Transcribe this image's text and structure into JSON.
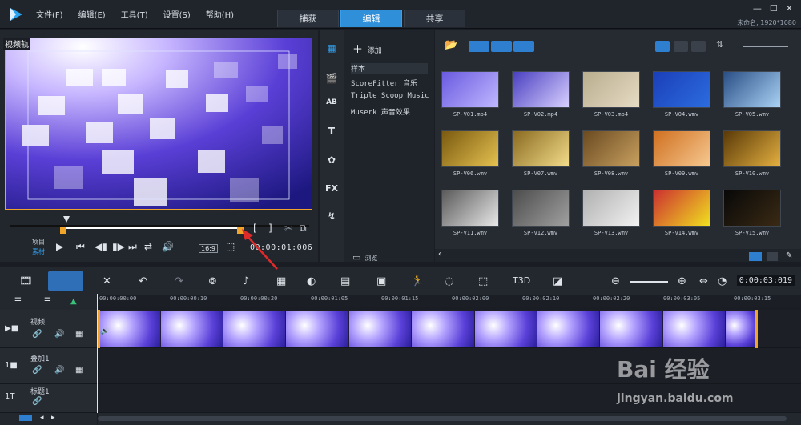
{
  "menu": [
    "文件(F)",
    "编辑(E)",
    "工具(T)",
    "设置(S)",
    "帮助(H)"
  ],
  "tabs": [
    {
      "label": "捕获"
    },
    {
      "label": "编辑",
      "active": true
    },
    {
      "label": "共享"
    }
  ],
  "project_info": "未命名, 1920*1080",
  "preview": {
    "track_label": "视频轨",
    "mode_project": "项目",
    "mode_clip": "素材",
    "aspect": "16:9",
    "timecode": "00:00:01:006"
  },
  "library": {
    "add_label": "添加",
    "items": [
      "样本",
      "ScoreFitter 音乐",
      "Triple Scoop Music",
      "Muserk 声音效果"
    ],
    "browse_label": "浏览"
  },
  "media": {
    "files": [
      "SP-V01.mp4",
      "SP-V02.mp4",
      "SP-V03.mp4",
      "SP-V04.wmv",
      "SP-V05.wmv",
      "SP-V06.wmv",
      "SP-V07.wmv",
      "SP-V08.wmv",
      "SP-V09.wmv",
      "SP-V10.wmv",
      "SP-V11.wmv",
      "SP-V12.wmv",
      "SP-V13.wmv",
      "SP-V14.wmv",
      "SP-V15.wmv"
    ]
  },
  "timeline": {
    "time": "0:00:03:019",
    "ruler": [
      "00:00:00:00",
      "00:00:00:10",
      "00:00:00:20",
      "00:00:01:05",
      "00:00:01:15",
      "00:00:02:00",
      "00:00:02:10",
      "00:00:02:20",
      "00:00:03:05",
      "00:00:03:15"
    ],
    "tracks": [
      {
        "name": "视频"
      },
      {
        "name": "叠加1"
      },
      {
        "name": "标题1"
      }
    ]
  },
  "watermark": {
    "brand": "Bai 经验",
    "url": "jingyan.baidu.com"
  }
}
